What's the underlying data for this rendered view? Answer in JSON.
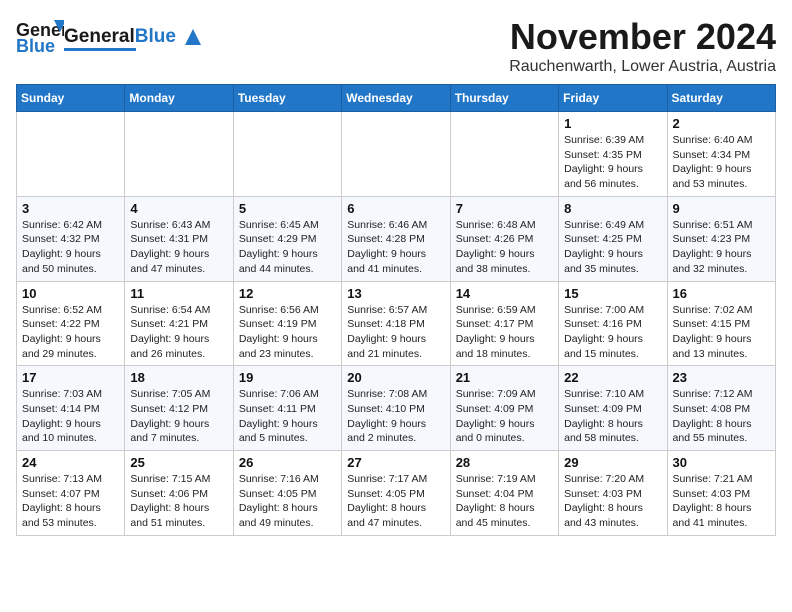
{
  "header": {
    "logo_general": "General",
    "logo_blue": "Blue",
    "month": "November 2024",
    "location": "Rauchenwarth, Lower Austria, Austria"
  },
  "weekdays": [
    "Sunday",
    "Monday",
    "Tuesday",
    "Wednesday",
    "Thursday",
    "Friday",
    "Saturday"
  ],
  "weeks": [
    [
      {
        "day": "",
        "info": ""
      },
      {
        "day": "",
        "info": ""
      },
      {
        "day": "",
        "info": ""
      },
      {
        "day": "",
        "info": ""
      },
      {
        "day": "",
        "info": ""
      },
      {
        "day": "1",
        "info": "Sunrise: 6:39 AM\nSunset: 4:35 PM\nDaylight: 9 hours\nand 56 minutes."
      },
      {
        "day": "2",
        "info": "Sunrise: 6:40 AM\nSunset: 4:34 PM\nDaylight: 9 hours\nand 53 minutes."
      }
    ],
    [
      {
        "day": "3",
        "info": "Sunrise: 6:42 AM\nSunset: 4:32 PM\nDaylight: 9 hours\nand 50 minutes."
      },
      {
        "day": "4",
        "info": "Sunrise: 6:43 AM\nSunset: 4:31 PM\nDaylight: 9 hours\nand 47 minutes."
      },
      {
        "day": "5",
        "info": "Sunrise: 6:45 AM\nSunset: 4:29 PM\nDaylight: 9 hours\nand 44 minutes."
      },
      {
        "day": "6",
        "info": "Sunrise: 6:46 AM\nSunset: 4:28 PM\nDaylight: 9 hours\nand 41 minutes."
      },
      {
        "day": "7",
        "info": "Sunrise: 6:48 AM\nSunset: 4:26 PM\nDaylight: 9 hours\nand 38 minutes."
      },
      {
        "day": "8",
        "info": "Sunrise: 6:49 AM\nSunset: 4:25 PM\nDaylight: 9 hours\nand 35 minutes."
      },
      {
        "day": "9",
        "info": "Sunrise: 6:51 AM\nSunset: 4:23 PM\nDaylight: 9 hours\nand 32 minutes."
      }
    ],
    [
      {
        "day": "10",
        "info": "Sunrise: 6:52 AM\nSunset: 4:22 PM\nDaylight: 9 hours\nand 29 minutes."
      },
      {
        "day": "11",
        "info": "Sunrise: 6:54 AM\nSunset: 4:21 PM\nDaylight: 9 hours\nand 26 minutes."
      },
      {
        "day": "12",
        "info": "Sunrise: 6:56 AM\nSunset: 4:19 PM\nDaylight: 9 hours\nand 23 minutes."
      },
      {
        "day": "13",
        "info": "Sunrise: 6:57 AM\nSunset: 4:18 PM\nDaylight: 9 hours\nand 21 minutes."
      },
      {
        "day": "14",
        "info": "Sunrise: 6:59 AM\nSunset: 4:17 PM\nDaylight: 9 hours\nand 18 minutes."
      },
      {
        "day": "15",
        "info": "Sunrise: 7:00 AM\nSunset: 4:16 PM\nDaylight: 9 hours\nand 15 minutes."
      },
      {
        "day": "16",
        "info": "Sunrise: 7:02 AM\nSunset: 4:15 PM\nDaylight: 9 hours\nand 13 minutes."
      }
    ],
    [
      {
        "day": "17",
        "info": "Sunrise: 7:03 AM\nSunset: 4:14 PM\nDaylight: 9 hours\nand 10 minutes."
      },
      {
        "day": "18",
        "info": "Sunrise: 7:05 AM\nSunset: 4:12 PM\nDaylight: 9 hours\nand 7 minutes."
      },
      {
        "day": "19",
        "info": "Sunrise: 7:06 AM\nSunset: 4:11 PM\nDaylight: 9 hours\nand 5 minutes."
      },
      {
        "day": "20",
        "info": "Sunrise: 7:08 AM\nSunset: 4:10 PM\nDaylight: 9 hours\nand 2 minutes."
      },
      {
        "day": "21",
        "info": "Sunrise: 7:09 AM\nSunset: 4:09 PM\nDaylight: 9 hours\nand 0 minutes."
      },
      {
        "day": "22",
        "info": "Sunrise: 7:10 AM\nSunset: 4:09 PM\nDaylight: 8 hours\nand 58 minutes."
      },
      {
        "day": "23",
        "info": "Sunrise: 7:12 AM\nSunset: 4:08 PM\nDaylight: 8 hours\nand 55 minutes."
      }
    ],
    [
      {
        "day": "24",
        "info": "Sunrise: 7:13 AM\nSunset: 4:07 PM\nDaylight: 8 hours\nand 53 minutes."
      },
      {
        "day": "25",
        "info": "Sunrise: 7:15 AM\nSunset: 4:06 PM\nDaylight: 8 hours\nand 51 minutes."
      },
      {
        "day": "26",
        "info": "Sunrise: 7:16 AM\nSunset: 4:05 PM\nDaylight: 8 hours\nand 49 minutes."
      },
      {
        "day": "27",
        "info": "Sunrise: 7:17 AM\nSunset: 4:05 PM\nDaylight: 8 hours\nand 47 minutes."
      },
      {
        "day": "28",
        "info": "Sunrise: 7:19 AM\nSunset: 4:04 PM\nDaylight: 8 hours\nand 45 minutes."
      },
      {
        "day": "29",
        "info": "Sunrise: 7:20 AM\nSunset: 4:03 PM\nDaylight: 8 hours\nand 43 minutes."
      },
      {
        "day": "30",
        "info": "Sunrise: 7:21 AM\nSunset: 4:03 PM\nDaylight: 8 hours\nand 41 minutes."
      }
    ]
  ]
}
